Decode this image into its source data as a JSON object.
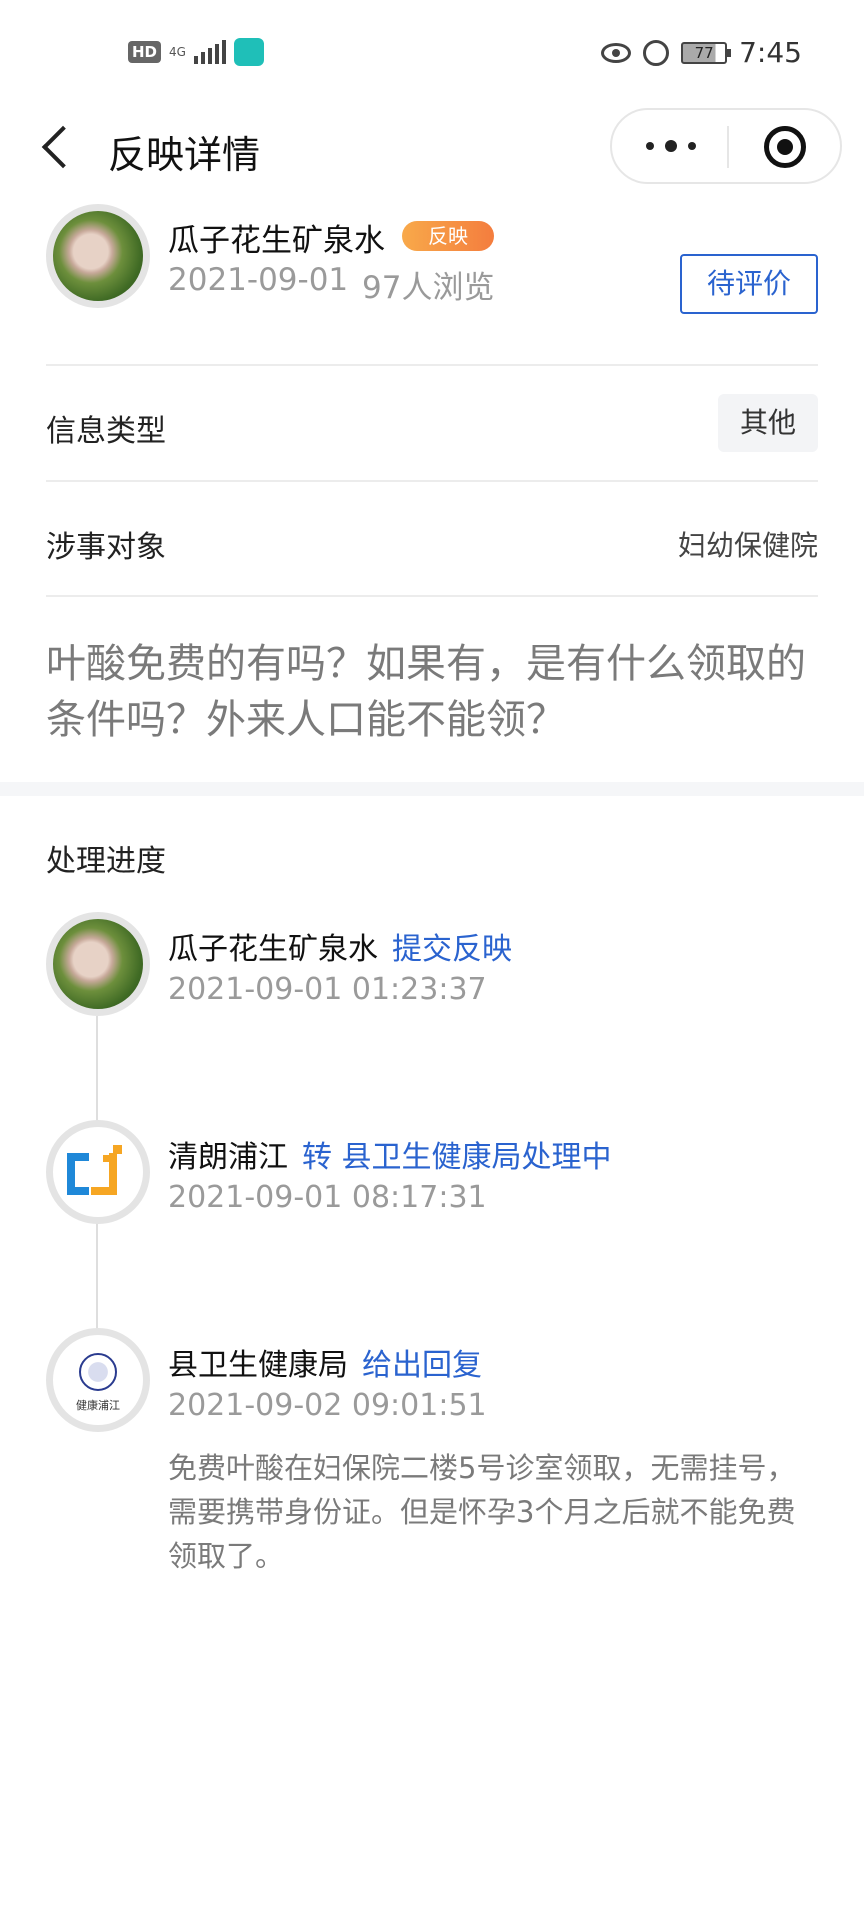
{
  "status_bar": {
    "hd_label": "HD",
    "network_label": "4G",
    "battery_level": "77",
    "time": "7:45",
    "icons": [
      "signal-icon",
      "app-icon",
      "eye-icon",
      "alarm-icon",
      "battery-icon"
    ]
  },
  "nav": {
    "title": "反映详情",
    "icons": [
      "back-icon",
      "more-icon",
      "close-target-icon"
    ]
  },
  "post": {
    "user_name": "瓜子花生矿泉水",
    "tag": "反映",
    "date": "2021-09-01",
    "views": "97人浏览",
    "status": "待评价",
    "info_type_label": "信息类型",
    "info_type_value": "其他",
    "target_label": "涉事对象",
    "target_value": "妇幼保健院",
    "content": "叶酸免费的有吗？如果有，是有什么领取的条件吗？外来人口能不能领？"
  },
  "progress": {
    "title": "处理进度",
    "steps": [
      {
        "name": "瓜子花生矿泉水",
        "action": "提交反映",
        "time": "2021-09-01 01:23:37"
      },
      {
        "name": "清朗浦江",
        "action": "转 县卫生健康局处理中",
        "time": "2021-09-01 08:17:31"
      },
      {
        "name": "县卫生健康局",
        "action": "给出回复",
        "time": "2021-09-02 09:01:51",
        "logo_text": "健康浦江",
        "reply": "免费叶酸在妇保院二楼5号诊室领取，无需挂号，需要携带身份证。但是怀孕3个月之后就不能免费领取了。"
      }
    ]
  },
  "colors": {
    "link_blue": "#2a63cf",
    "tag_orange": "#f47d3e",
    "muted_text": "#9a9a9a"
  }
}
